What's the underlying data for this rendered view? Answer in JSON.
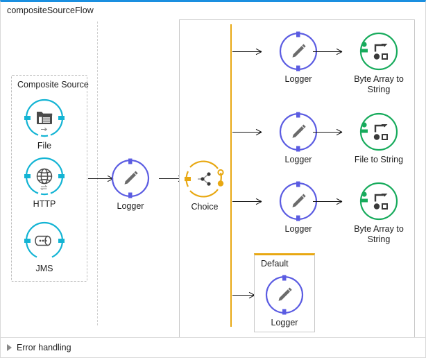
{
  "window": {
    "flow_title": "compositeSourceFlow",
    "accent_top_border": "#1a8fe0"
  },
  "footer": {
    "error_handling_label": "Error handling",
    "toggle_icon": "triangle-right-icon"
  },
  "composite_source": {
    "title": "Composite Source",
    "items": [
      {
        "label": "File",
        "icon": "file-icon",
        "color": "#13b4d4"
      },
      {
        "label": "HTTP",
        "icon": "globe-icon",
        "color": "#13b4d4"
      },
      {
        "label": "JMS",
        "icon": "jms-queue-icon",
        "color": "#13b4d4"
      }
    ]
  },
  "main_logger": {
    "label": "Logger",
    "icon": "pencil-icon",
    "color": "#5b5ce2"
  },
  "choice": {
    "label": "Choice",
    "icon": "choice-branch-icon",
    "color": "#e8a812"
  },
  "branches": [
    {
      "logger": {
        "label": "Logger",
        "icon": "pencil-icon",
        "color": "#5b5ce2"
      },
      "transform": {
        "label": "Byte Array to\nString",
        "icon": "transform-icon",
        "color": "#17ab5c"
      }
    },
    {
      "logger": {
        "label": "Logger",
        "icon": "pencil-icon",
        "color": "#5b5ce2"
      },
      "transform": {
        "label": "File to String",
        "icon": "transform-icon",
        "color": "#17ab5c"
      }
    },
    {
      "logger": {
        "label": "Logger",
        "icon": "pencil-icon",
        "color": "#5b5ce2"
      },
      "transform": {
        "label": "Byte Array to\nString",
        "icon": "transform-icon",
        "color": "#17ab5c"
      }
    }
  ],
  "default_branch": {
    "title": "Default",
    "logger": {
      "label": "Logger",
      "icon": "pencil-icon",
      "color": "#5b5ce2"
    }
  },
  "colors": {
    "source_teal": "#13b4d4",
    "logger_purple": "#5b5ce2",
    "choice_yellow": "#e8a812",
    "transform_green": "#17ab5c",
    "titlebar_blue": "#1a8fe0",
    "panel_border": "#c8c8c8"
  }
}
